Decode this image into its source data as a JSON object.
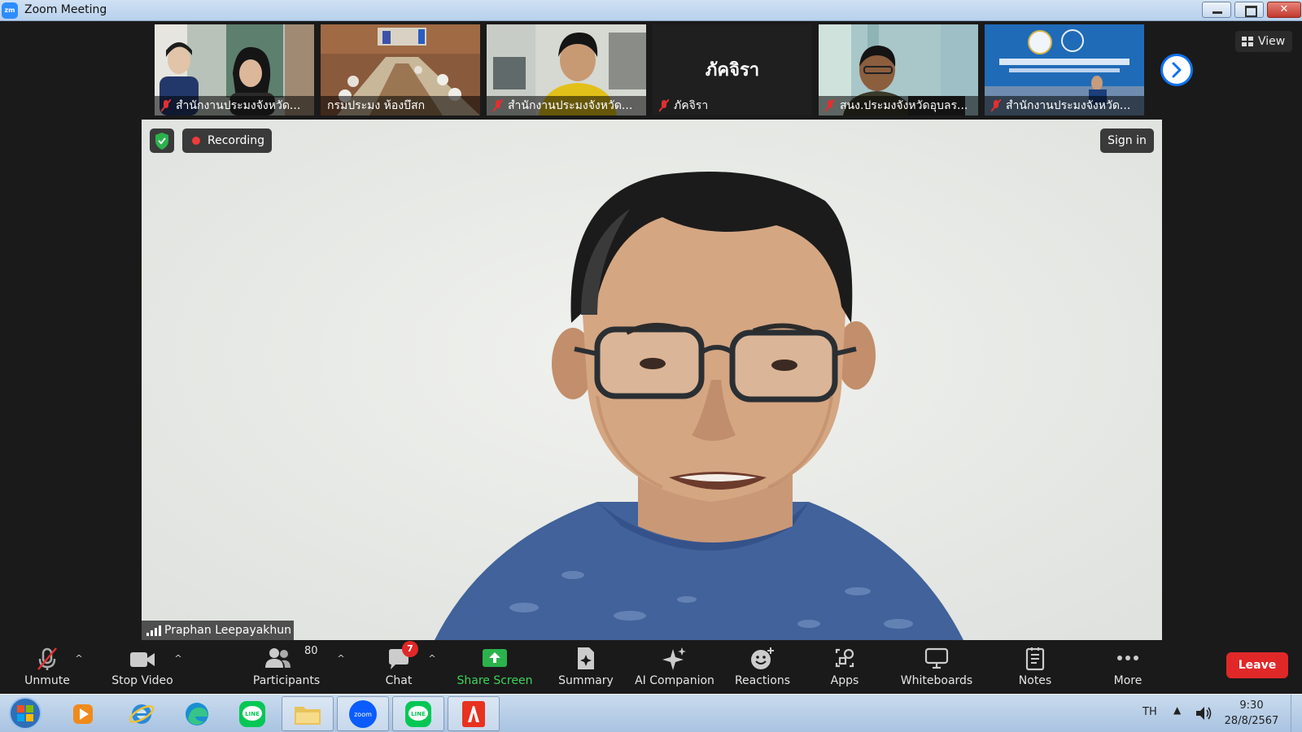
{
  "window": {
    "title": "Zoom Meeting",
    "app_logo_text": "zm"
  },
  "gallery": {
    "tiles": [
      {
        "name": "สำนักงานประมงจังหวัด...",
        "muted": true
      },
      {
        "name": "กรมประมง ห้องบึสก",
        "muted": false
      },
      {
        "name": "สำนักงานประมงจังหวัด...",
        "muted": true
      },
      {
        "name": "ภัคจิรา",
        "muted": true,
        "video_off": true,
        "display_name": "ภัคจิรา"
      },
      {
        "name": "สนง.ประมงจังหวัดอุบลร...",
        "muted": true
      },
      {
        "name": "สำนักงานประมงจังหวัด...",
        "muted": true
      }
    ],
    "view_label": "View"
  },
  "main": {
    "recording_label": "Recording",
    "sign_in_label": "Sign in",
    "speaker_name": "Praphan Leepayakhun"
  },
  "toolbar": {
    "unmute": "Unmute",
    "stop_video": "Stop Video",
    "participants": "Participants",
    "participants_count": "80",
    "chat": "Chat",
    "chat_badge": "7",
    "share_screen": "Share Screen",
    "summary": "Summary",
    "ai_companion": "AI Companion",
    "reactions": "Reactions",
    "apps": "Apps",
    "whiteboards": "Whiteboards",
    "notes": "Notes",
    "more": "More",
    "leave": "Leave"
  },
  "taskbar": {
    "apps": [
      "windows-media-player-icon",
      "internet-explorer-icon",
      "edge-icon",
      "line-icon",
      "file-explorer-icon",
      "zoom-icon",
      "line-icon",
      "acrobat-icon"
    ],
    "zoom_icon_text": "zoom",
    "line_icon_text": "LINE",
    "language": "TH",
    "time": "9:30",
    "date": "28/8/2567"
  },
  "colors": {
    "zoom_blue": "#2d8cff",
    "leave_red": "#e02828",
    "share_green": "#3ad45a",
    "toolbar_bg": "#1a1a1a"
  }
}
